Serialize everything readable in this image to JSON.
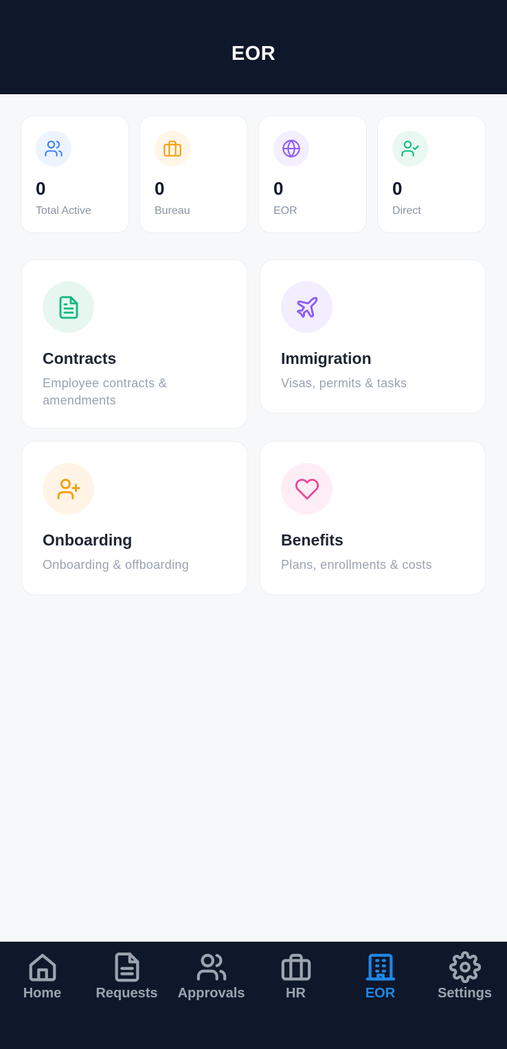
{
  "header": {
    "title": "EOR"
  },
  "stats": [
    {
      "value": "0",
      "label": "Total Active",
      "icon": "users-icon",
      "color": "#3b82f6",
      "bg": "#eef4ff"
    },
    {
      "value": "0",
      "label": "Bureau",
      "icon": "briefcase-icon",
      "color": "#f59e0b",
      "bg": "#fff6e8"
    },
    {
      "value": "0",
      "label": "EOR",
      "icon": "globe-icon",
      "color": "#8b5cf6",
      "bg": "#f3efff"
    },
    {
      "value": "0",
      "label": "Direct",
      "icon": "user-check-icon",
      "color": "#10b981",
      "bg": "#e9f8f1"
    }
  ],
  "modules": [
    {
      "title": "Contracts",
      "desc": "Employee contracts & amendments",
      "icon": "file-text-icon",
      "color": "#10b981",
      "bg": "#e7f7ef"
    },
    {
      "title": "Immigration",
      "desc": "Visas, permits & tasks",
      "icon": "plane-icon",
      "color": "#8b5cf6",
      "bg": "#f2edff"
    },
    {
      "title": "Onboarding",
      "desc": "Onboarding & offboarding",
      "icon": "user-plus-icon",
      "color": "#f59e0b",
      "bg": "#fff4e6"
    },
    {
      "title": "Benefits",
      "desc": "Plans, enrollments & costs",
      "icon": "heart-icon",
      "color": "#ec4899",
      "bg": "#fdeef5"
    }
  ],
  "nav": {
    "items": [
      {
        "label": "Home",
        "icon": "home-icon"
      },
      {
        "label": "Requests",
        "icon": "document-icon"
      },
      {
        "label": "Approvals",
        "icon": "users-icon"
      },
      {
        "label": "HR",
        "icon": "briefcase-icon"
      },
      {
        "label": "EOR",
        "icon": "building-icon",
        "active": true
      },
      {
        "label": "Settings",
        "icon": "gear-icon"
      }
    ],
    "inactive_color": "#9ca3af",
    "active_color": "#1e88e5"
  }
}
